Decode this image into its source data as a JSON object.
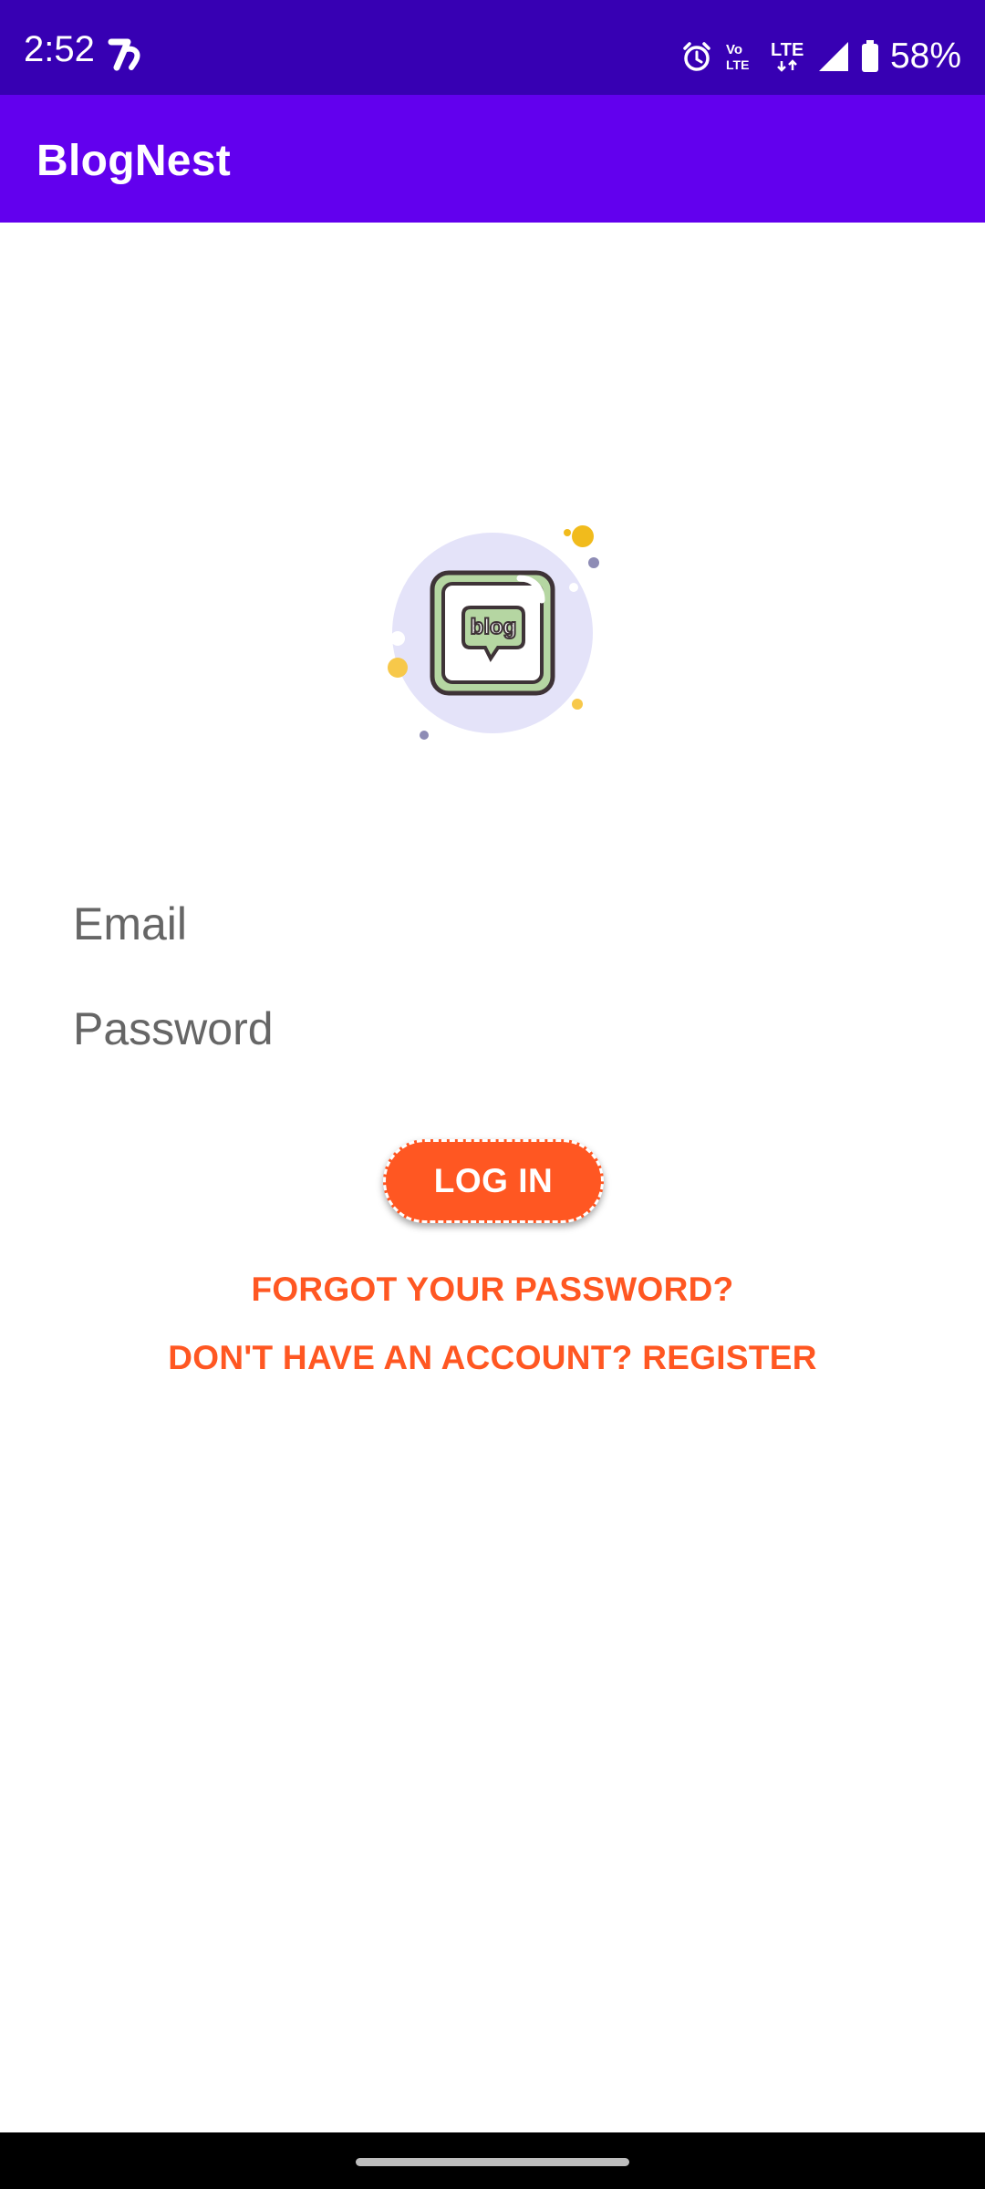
{
  "status_bar": {
    "time": "2:52",
    "battery": "58%",
    "network": "LTE",
    "icons": [
      "notification-app-icon",
      "alarm-icon",
      "volte-icon",
      "lte-icon",
      "signal-icon",
      "battery-icon"
    ]
  },
  "app_bar": {
    "title": "BlogNest"
  },
  "logo": {
    "text": "blog",
    "icon": "blog-logo-icon"
  },
  "form": {
    "email_placeholder": "Email",
    "email_value": "",
    "password_placeholder": "Password",
    "password_value": ""
  },
  "actions": {
    "login_label": "LOG IN",
    "forgot_label": "FORGOT YOUR PASSWORD?",
    "register_label": "DON'T HAVE AN ACCOUNT? REGISTER"
  },
  "colors": {
    "status_bar": "#3700b3",
    "app_bar": "#6200ee",
    "accent": "#ff5722",
    "background": "#ffffff"
  }
}
